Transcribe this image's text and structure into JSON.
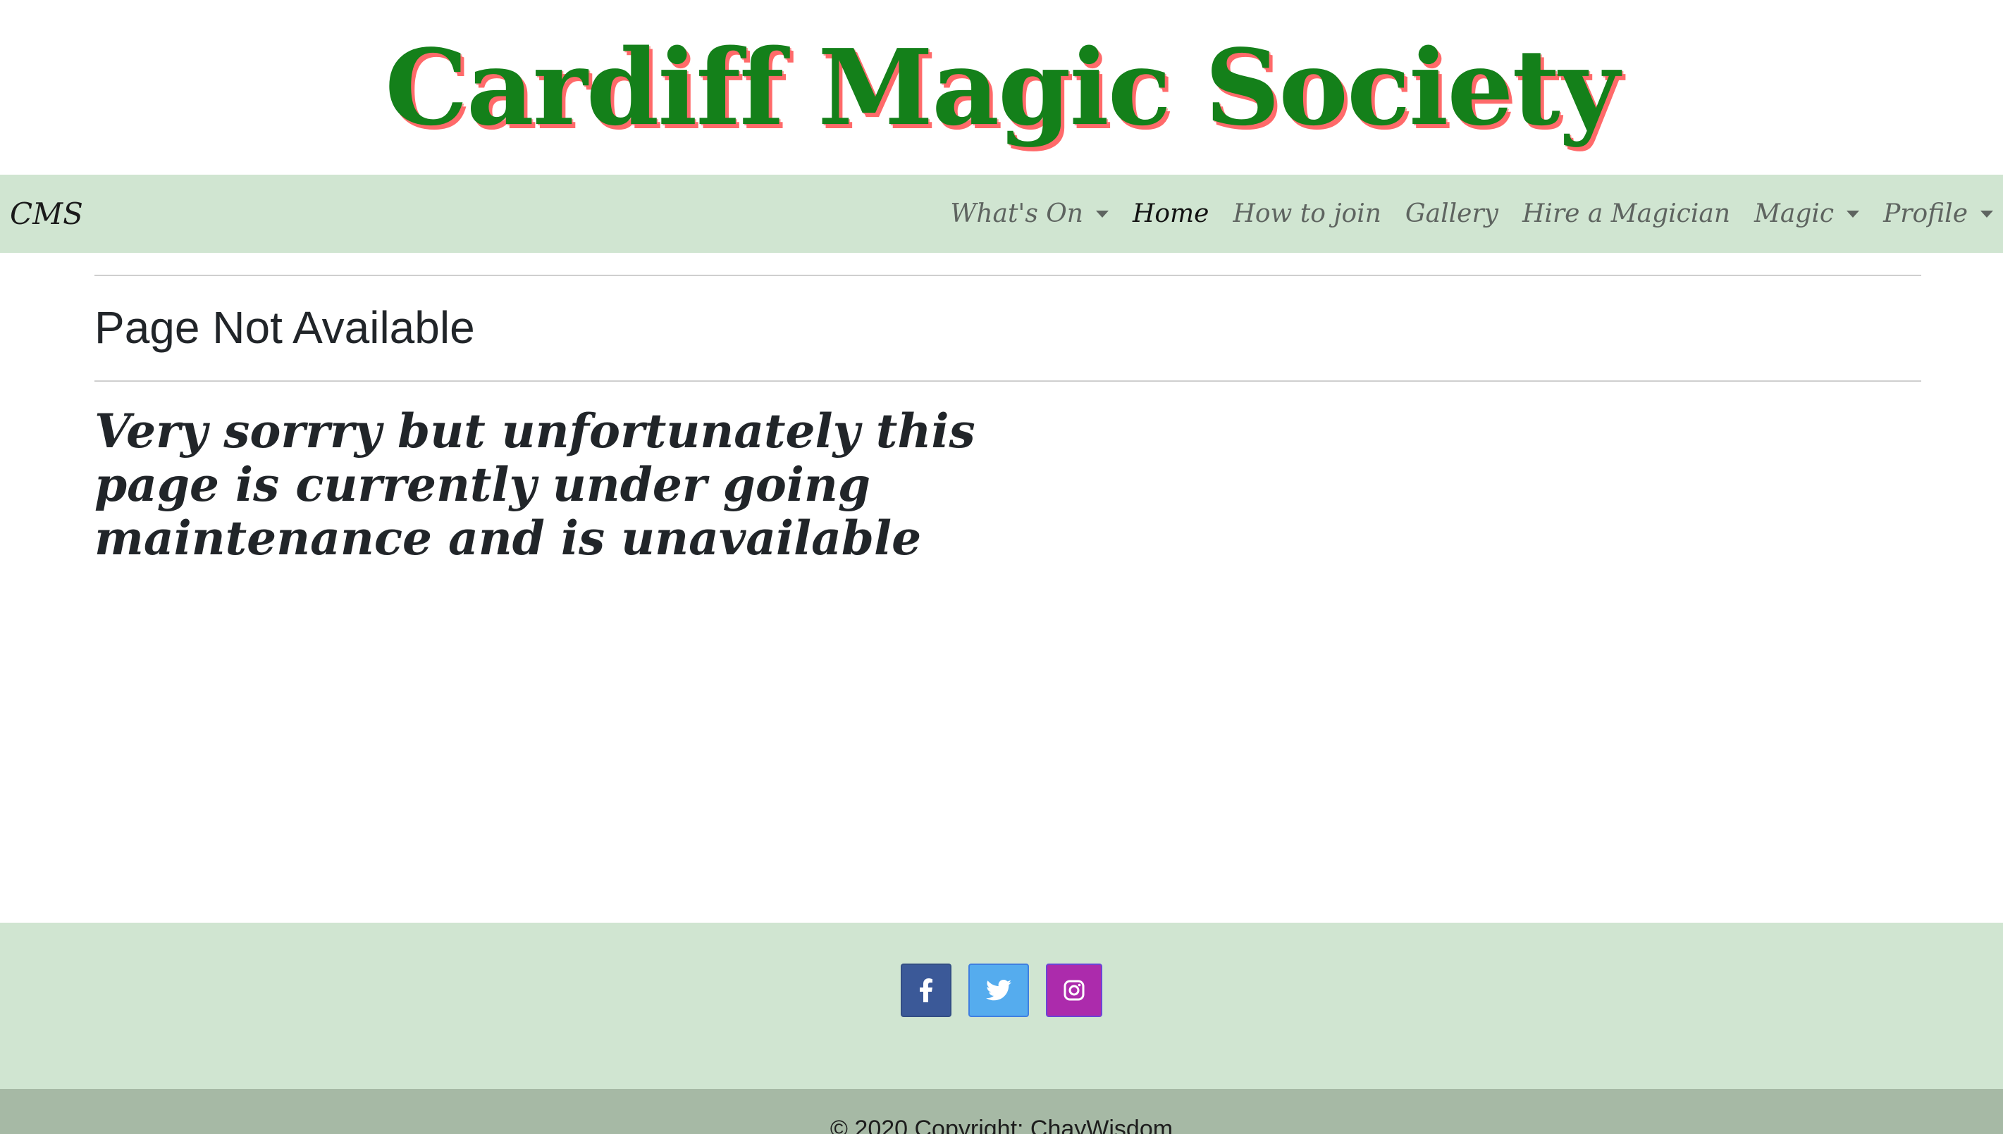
{
  "header": {
    "title": "Cardiff Magic Society"
  },
  "navbar": {
    "brand": "CMS",
    "items": [
      {
        "label": "What's On",
        "dropdown": true,
        "active": false
      },
      {
        "label": "Home",
        "dropdown": false,
        "active": true
      },
      {
        "label": "How to join",
        "dropdown": false,
        "active": false
      },
      {
        "label": "Gallery",
        "dropdown": false,
        "active": false
      },
      {
        "label": "Hire a Magician",
        "dropdown": false,
        "active": false
      },
      {
        "label": "Magic",
        "dropdown": true,
        "active": false
      },
      {
        "label": "Profile",
        "dropdown": true,
        "active": false
      }
    ]
  },
  "main": {
    "heading": "Page Not Available",
    "message": "Very sorrry but unfortunately this page is currently under going maintenance and is unavailable"
  },
  "footer": {
    "social": [
      {
        "name": "facebook-icon",
        "color": "#3b5998"
      },
      {
        "name": "twitter-icon",
        "color": "#55acee"
      },
      {
        "name": "instagram-icon",
        "color": "#ac2bac"
      }
    ],
    "copyright": "© 2020 Copyright: ChayWisdom"
  },
  "colors": {
    "title_green": "#14801a",
    "title_shadow": "#ff6a6a",
    "nav_bg": "#d0e5d1",
    "copyright_bg": "#a6b9a5"
  }
}
